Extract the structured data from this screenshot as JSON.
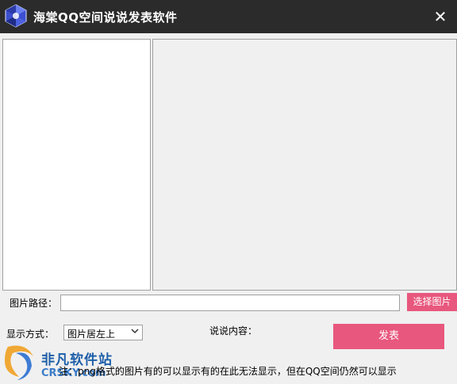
{
  "window": {
    "title": "海棠QQ空间说说发表软件",
    "close_glyph": "✕",
    "accent_color": "#e8577d",
    "titlebar_color": "#2b2b2b"
  },
  "form": {
    "image_path_label": "图片路径：",
    "image_path_value": "",
    "choose_image_button": "选择图片",
    "display_mode_label": "显示方式：",
    "display_mode_selected": "图片居左上",
    "content_label": "说说内容：",
    "post_button": "发表"
  },
  "note": "注：png格式的图片有的可以显示有的在此无法显示，但在QQ空间仍然可以显示",
  "watermark": {
    "brand": "非凡软件站",
    "site": "CRSKY.com"
  },
  "icons": {
    "app": "crystal-gem-icon",
    "close": "close-icon",
    "dropdown": "chevron-down-icon",
    "watermark": "watermark-logo-icon"
  }
}
